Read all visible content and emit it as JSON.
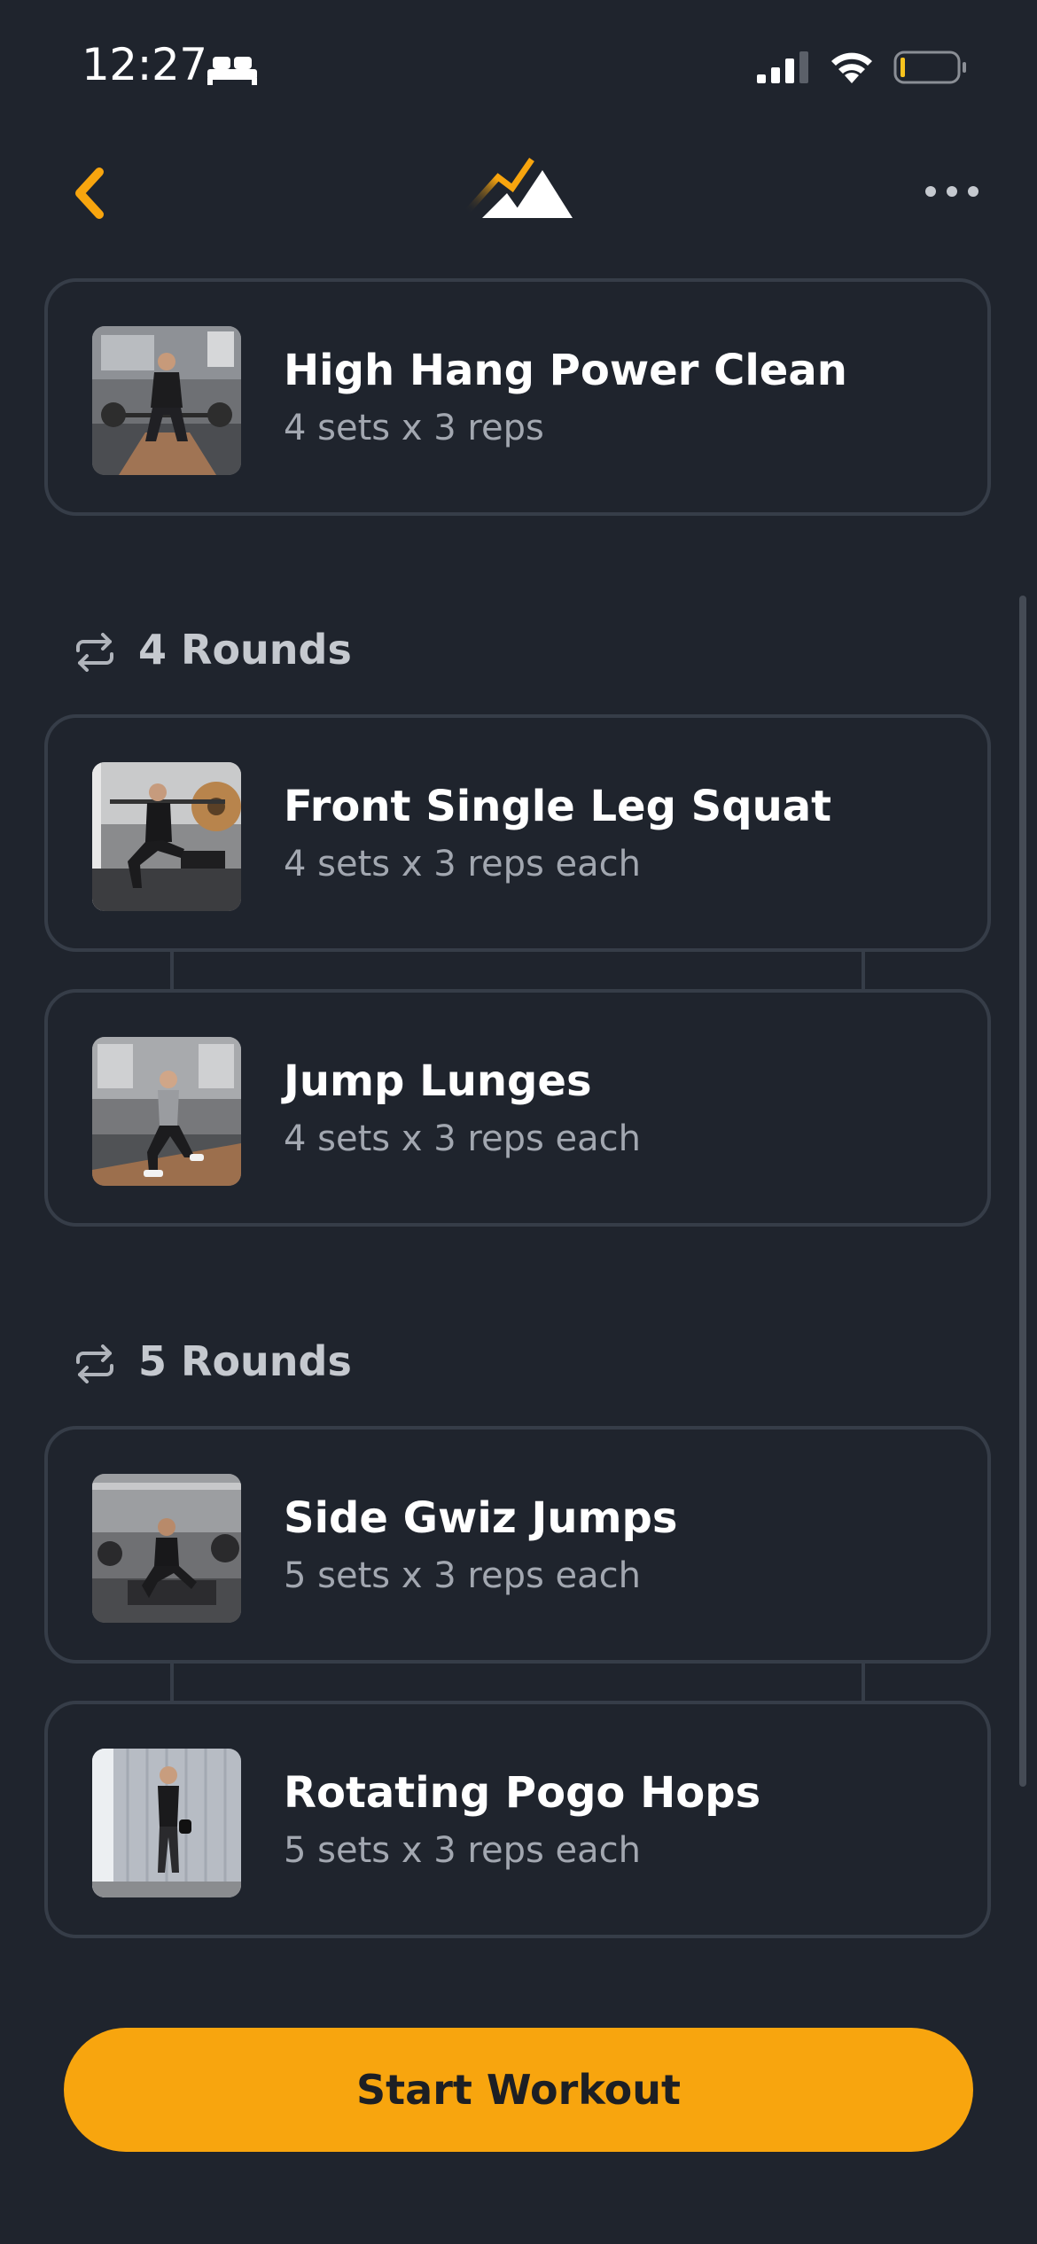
{
  "status_bar": {
    "time": "12:27",
    "sleep_icon": "bed-icon",
    "signal_icon": "cellular-signal-icon",
    "wifi_icon": "wifi-icon",
    "battery_icon": "battery-low-icon"
  },
  "nav": {
    "back_icon": "chevron-left-icon",
    "logo": "mountain-logo",
    "more_icon": "more-horizontal-icon"
  },
  "colors": {
    "background": "#1f242d",
    "card_border": "#363d48",
    "accent": "#f8a50e",
    "subtitle": "#a2a7b0"
  },
  "workout": {
    "single_exercise": {
      "name": "High Hang Power Clean",
      "sets": "4 sets x 3 reps"
    },
    "circuits": [
      {
        "rounds_label": "4 Rounds",
        "exercises": [
          {
            "name": "Front Single Leg Squat",
            "sets": "4 sets x 3 reps each"
          },
          {
            "name": "Jump Lunges",
            "sets": "4 sets x 3 reps each"
          }
        ]
      },
      {
        "rounds_label": "5 Rounds",
        "exercises": [
          {
            "name": "Side Gwiz Jumps",
            "sets": "5 sets x 3 reps each"
          },
          {
            "name": "Rotating Pogo Hops",
            "sets": "5 sets x 3 reps each"
          }
        ]
      }
    ]
  },
  "start_button_label": "Start Workout"
}
